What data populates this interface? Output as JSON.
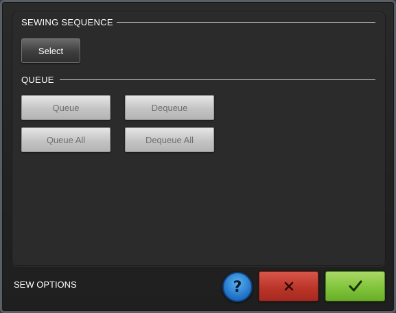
{
  "sections": {
    "sewing_sequence": {
      "title": "SEWING SEQUENCE",
      "select_label": "Select"
    },
    "queue": {
      "title": "QUEUE",
      "queue_label": "Queue",
      "dequeue_label": "Dequeue",
      "queue_all_label": "Queue All",
      "dequeue_all_label": "Dequeue All"
    }
  },
  "footer": {
    "label": "SEW OPTIONS",
    "help_glyph": "?",
    "icons": {
      "help": "help-icon",
      "cancel": "close-icon",
      "ok": "checkmark-icon"
    }
  },
  "colors": {
    "help": "#1e6fc4",
    "cancel": "#b93327",
    "ok": "#7ec238"
  }
}
